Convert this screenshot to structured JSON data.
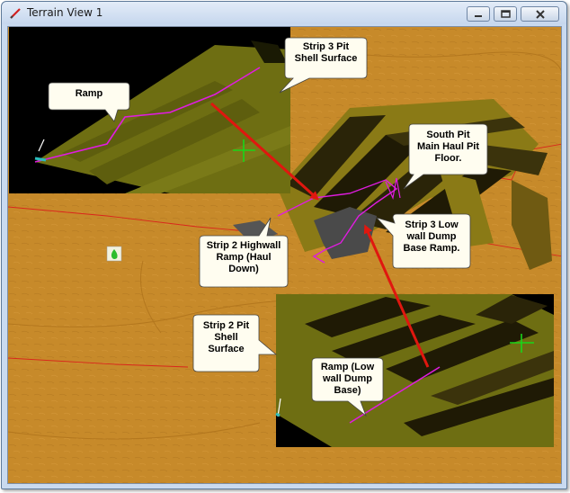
{
  "window": {
    "title": "Terrain View 1",
    "icon": "pencil-icon",
    "controls": [
      "minimize-icon",
      "maximize-icon",
      "close-icon"
    ]
  },
  "colors": {
    "terrain": "#c78a2a",
    "pit_surface": "#6e6e12",
    "route_line": "#e01ce0",
    "arrow": "#e0170f",
    "marker": "#19d619",
    "lease_line": "#d9261c"
  },
  "callouts": {
    "ramp": "Ramp",
    "strip3_pit_shell": "Strip 3 Pit\nShell Surface",
    "south_pit_main_haul": "South Pit\nMain Haul Pit\nFloor.",
    "strip3_lowwall_dump": "Strip 3 Low\nwall Dump\nBase Ramp.",
    "strip2_highwall_ramp": "Strip 2 Highwall\nRamp (Haul\nDown)",
    "strip2_pit_shell": "Strip 2 Pit\nShell\nSurface",
    "ramp_lowwall_dump": "Ramp (Low\nwall Dump\nBase)"
  },
  "map_icons": [
    "green-flame-icon",
    "green-crosshair-icon",
    "north-arrow-icon"
  ]
}
